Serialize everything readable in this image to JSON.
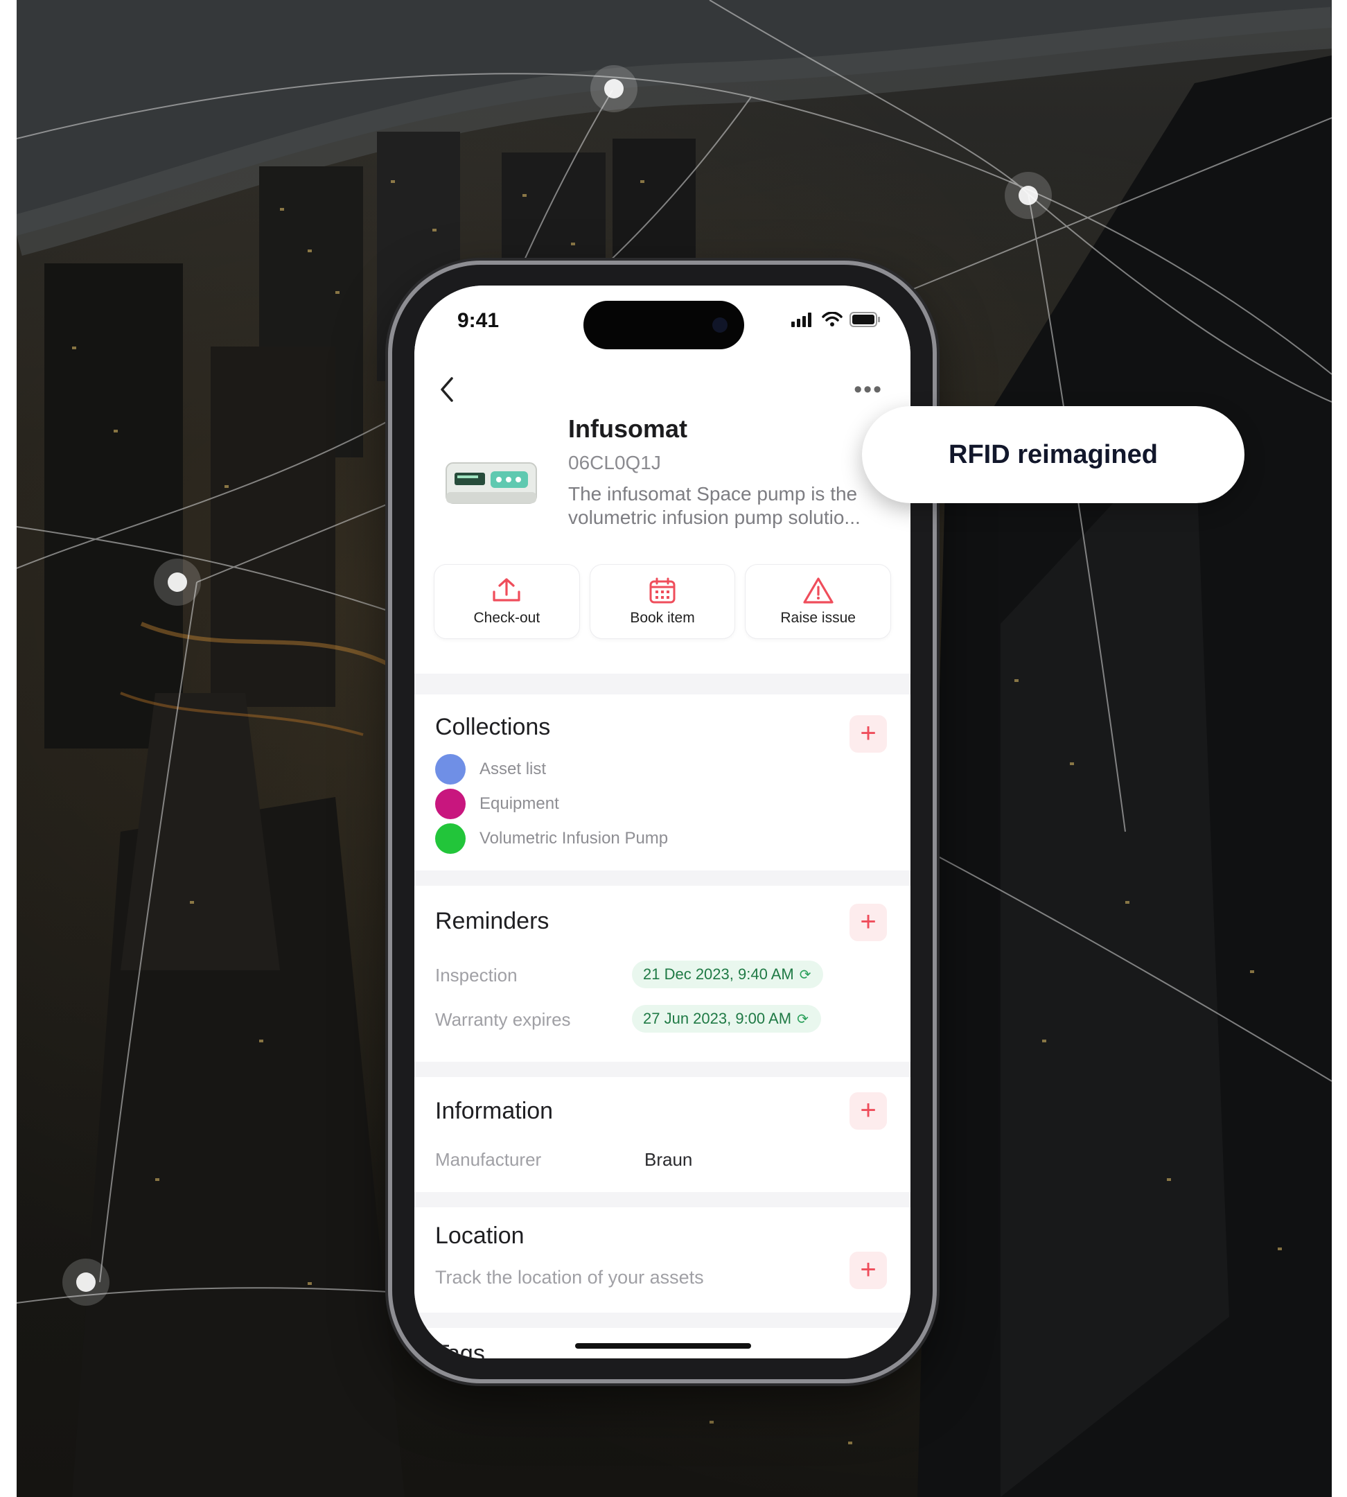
{
  "status_bar": {
    "time": "9:41"
  },
  "asset": {
    "name": "Infusomat",
    "code": "06CL0Q1J",
    "description": "The infusomat Space pump is the volumetric infusion pump solutio..."
  },
  "actions": [
    {
      "label": "Check-out",
      "icon": "upload-icon"
    },
    {
      "label": "Book item",
      "icon": "calendar-icon"
    },
    {
      "label": "Raise issue",
      "icon": "warning-icon"
    }
  ],
  "collections": {
    "title": "Collections",
    "items": [
      {
        "label": "Asset list",
        "color": "#6f8fe6"
      },
      {
        "label": "Equipment",
        "color": "#c8167e"
      },
      {
        "label": "Volumetric Infusion Pump",
        "color": "#22c53a"
      }
    ]
  },
  "reminders": {
    "title": "Reminders",
    "rows": [
      {
        "label": "Inspection",
        "value": "21 Dec 2023, 9:40 AM"
      },
      {
        "label": "Warranty expires",
        "value": "27 Jun 2023, 9:00 AM"
      }
    ]
  },
  "information": {
    "title": "Information",
    "rows": [
      {
        "label": "Manufacturer",
        "value": "Braun"
      }
    ]
  },
  "location": {
    "title": "Location",
    "subtitle": "Track the location of your assets"
  },
  "tags": {
    "title": "Tags"
  },
  "callout": {
    "text": "RFID reimagined"
  },
  "colors": {
    "accent_red": "#ef4d5b",
    "pill_green_bg": "#e9f7ee",
    "pill_green_text": "#1f7a45"
  }
}
